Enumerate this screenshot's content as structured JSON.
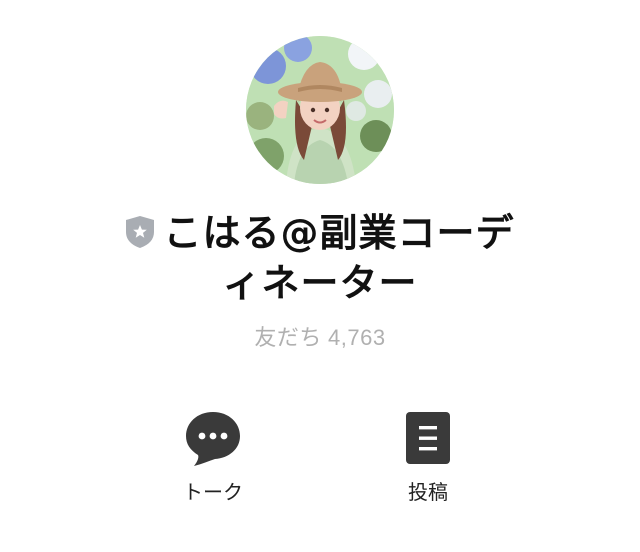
{
  "profile": {
    "name_line1": "こはる@副業コーデ",
    "name_line2": "ィネーター",
    "friends_label": "友だち",
    "friends_count": "4,763",
    "badge_icon": "shield-star-icon"
  },
  "actions": [
    {
      "label": "トーク",
      "icon": "chat-bubble-icon"
    },
    {
      "label": "投稿",
      "icon": "post-list-icon"
    }
  ],
  "colors": {
    "text": "#111111",
    "muted": "#b0b0b0",
    "icon": "#3a3a3a",
    "badge": "#a9adb3"
  }
}
